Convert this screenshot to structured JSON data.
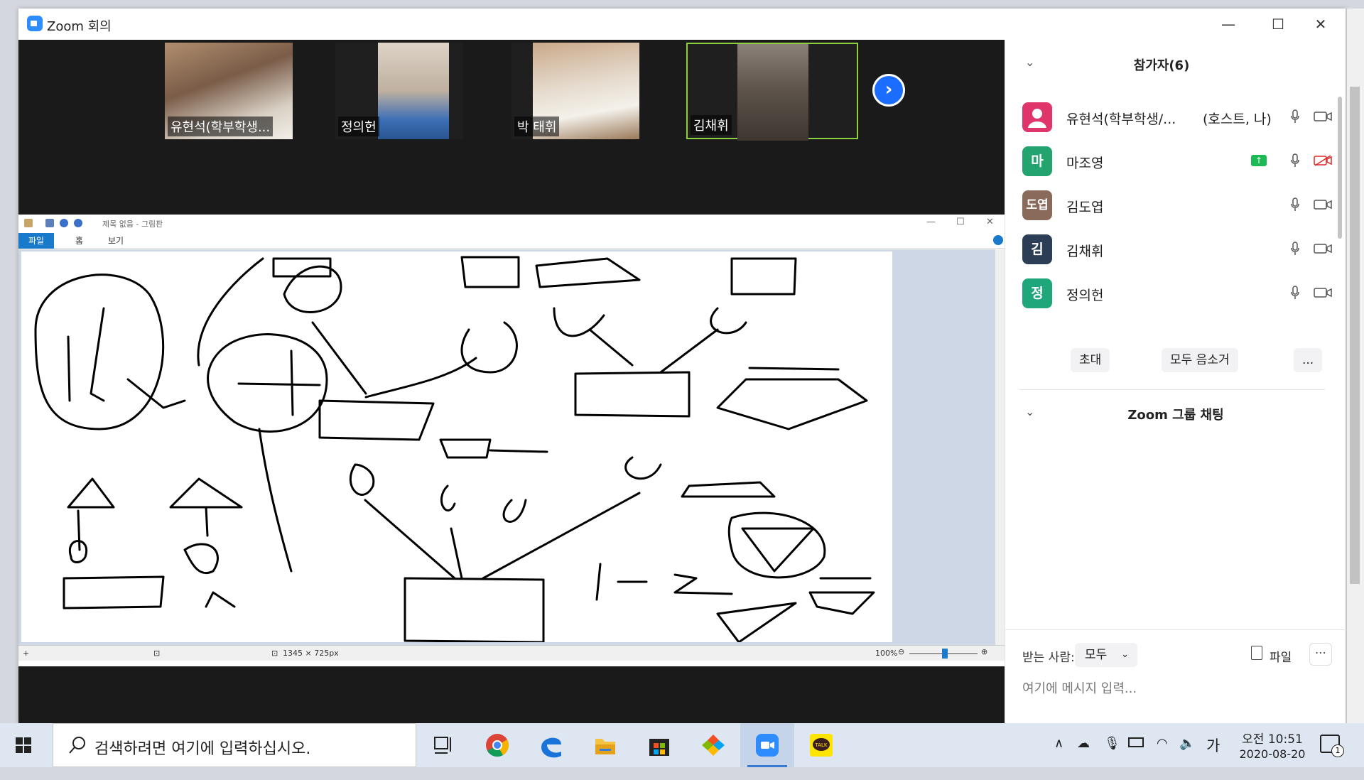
{
  "window": {
    "title": "Zoom 회의"
  },
  "videos": [
    {
      "name": "유현석(학부학생..."
    },
    {
      "name": "정의헌"
    },
    {
      "name": "박 태휘"
    },
    {
      "name": "김채휘"
    }
  ],
  "paint": {
    "doc_title": "제목 없음 - 그림판",
    "tabs": [
      "파일",
      "홈",
      "보기"
    ],
    "status_size": "1345 × 725px",
    "zoom": "100%"
  },
  "participants": {
    "header": "참가자(6)",
    "list": [
      {
        "avatar": "",
        "name": "유현석(학부학생/...",
        "role": "(호스트, 나)",
        "avatar_color": "#e0356b"
      },
      {
        "avatar": "마",
        "name": "마조영",
        "role": "",
        "avatar_color": "#23a46e"
      },
      {
        "avatar": "도엽",
        "name": "김도엽",
        "role": "",
        "avatar_color": "#8a6a5a"
      },
      {
        "avatar": "김",
        "name": "김채휘",
        "role": "",
        "avatar_color": "#2c3e55"
      },
      {
        "avatar": "정",
        "name": "정의헌",
        "role": "",
        "avatar_color": "#1fa67a"
      }
    ],
    "buttons": {
      "invite": "초대",
      "mute_all": "모두 음소거",
      "more": "..."
    }
  },
  "chat": {
    "header": "Zoom 그룹 채팅",
    "to_label": "받는 사람:",
    "recipient": "모두",
    "file_label": "파일",
    "placeholder": "여기에 메시지 입력..."
  },
  "taskbar": {
    "search_text": "검색하려면 여기에 입력하십시오.",
    "ime": "가",
    "time": "오전 10:51",
    "date": "2020-08-20",
    "notifications": "1"
  },
  "colors": {
    "zoom_blue": "#2d8cff",
    "active_border": "#8ccf3f",
    "paint_file_tab": "#1979ca"
  }
}
